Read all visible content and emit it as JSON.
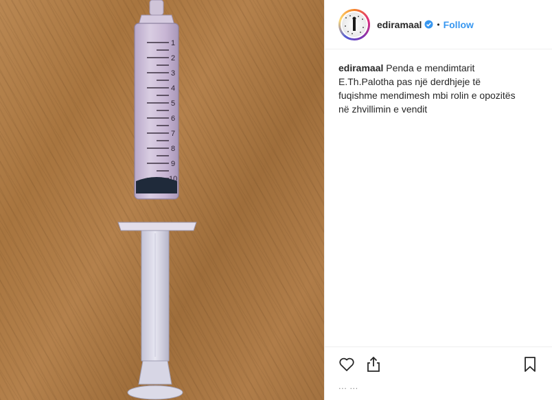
{
  "header": {
    "username": "ediramaal",
    "separator": "•",
    "follow_label": "Follow"
  },
  "caption": {
    "username": "ediramaal",
    "text": "Penda e mendimtarit E.Th.Palotha pas një derdhjeje të fuqishme mendimesh mbi rolin e opozitës në zhvillimin e vendit"
  },
  "photo": {
    "syringe_scale": [
      "1",
      "2",
      "3",
      "4",
      "5",
      "6",
      "7",
      "8",
      "9",
      "10"
    ]
  },
  "footer": {
    "partial_text": "... ..."
  },
  "icons": {
    "like": "heart-icon",
    "share": "share-icon",
    "save": "bookmark-icon",
    "verified": "verified-badge-icon"
  },
  "colors": {
    "link": "#3897f0",
    "text": "#262626",
    "border": "#efefef",
    "verified": "#3897f0"
  }
}
